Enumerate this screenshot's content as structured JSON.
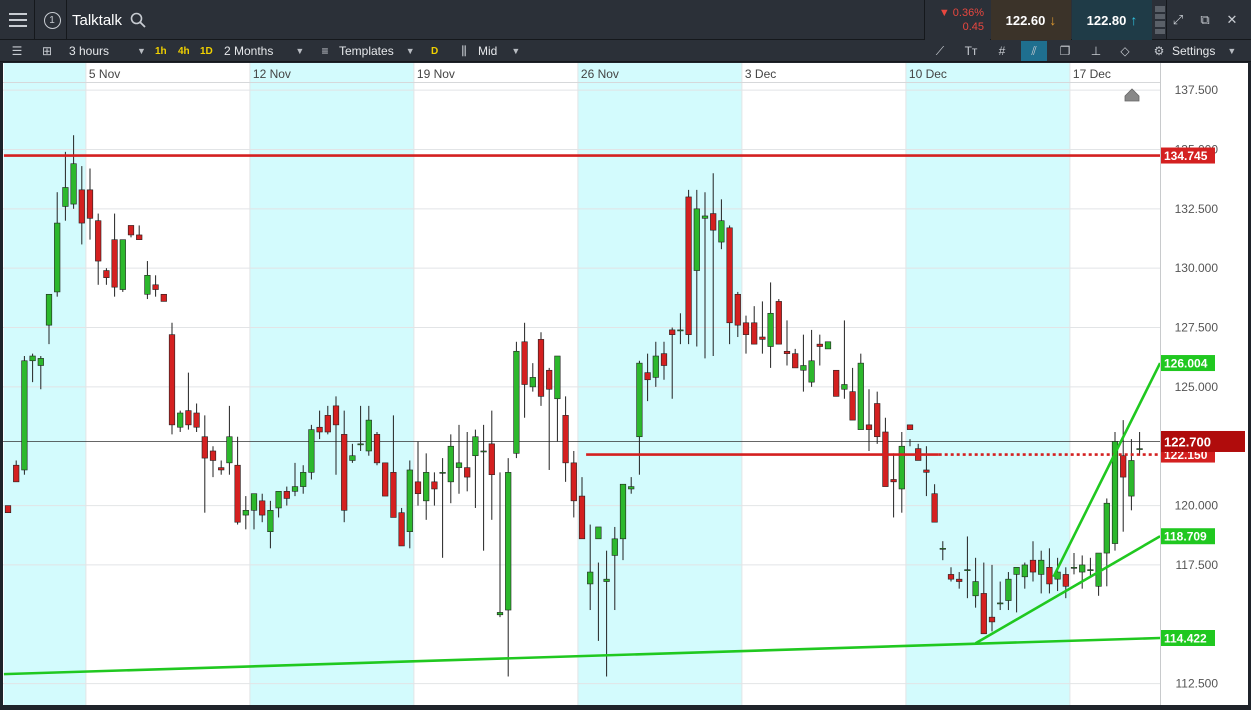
{
  "header": {
    "instrument": "Talktalk",
    "change_pct": "▼ 0.36%",
    "change_abs": "0.45",
    "sell_price": "122.60",
    "buy_price": "122.80"
  },
  "toolbar": {
    "interval": "3 hours",
    "tf_1h": "1h",
    "tf_4h": "4h",
    "tf_1d": "1D",
    "range": "2 Months",
    "templates": "Templates",
    "price_type_badge": "D",
    "price_type": "Mid",
    "settings": "Settings"
  },
  "icons": {
    "menu": "hamburger-menu-icon",
    "info": "info-icon",
    "search": "search-icon",
    "expand": "expand-icon",
    "popout": "popout-icon",
    "close": "close-icon",
    "draw": "draw-line-icon",
    "text": "text-icon",
    "crosshair": "crosshair-icon",
    "gear": "gear-icon"
  },
  "colors": {
    "up": "#2cb82c",
    "down": "#d42020",
    "band": "#d3fbfd",
    "red_line": "#d42020",
    "green_line": "#20c820"
  },
  "chart_data": {
    "type": "candlestick",
    "title": "",
    "xlabel": "",
    "ylabel": "",
    "ylim": [
      111.6,
      137.8
    ],
    "yticks": [
      "137.500",
      "135.000",
      "132.500",
      "130.000",
      "127.500",
      "125.000",
      "120.000",
      "117.500",
      "112.500"
    ],
    "ytick_values": [
      137.5,
      135.0,
      132.5,
      130.0,
      127.5,
      125.0,
      120.0,
      117.5,
      112.5
    ],
    "date_labels": [
      "5 Nov",
      "12 Nov",
      "19 Nov",
      "26 Nov",
      "3 Dec",
      "10 Dec",
      "17 Dec"
    ],
    "date_label_index": [
      9.5,
      29.5,
      49.5,
      69.5,
      89.5,
      109.5,
      129.5
    ],
    "shaded_bands_index": [
      [
        -0.5,
        9.5
      ],
      [
        29.5,
        49.5
      ],
      [
        69.5,
        89.5
      ],
      [
        109.5,
        129.5
      ]
    ],
    "candles": [
      [
        120.0,
        120.0,
        119.8,
        119.7
      ],
      [
        121.7,
        121.9,
        121.0,
        121.0
      ],
      [
        121.5,
        126.3,
        121.3,
        126.1
      ],
      [
        126.1,
        126.4,
        125.2,
        126.3
      ],
      [
        125.9,
        126.3,
        124.9,
        126.2
      ],
      [
        127.6,
        128.9,
        126.8,
        128.9
      ],
      [
        129.0,
        133.2,
        128.8,
        131.9
      ],
      [
        132.6,
        134.9,
        132.0,
        133.4
      ],
      [
        132.7,
        135.6,
        132.5,
        134.4
      ],
      [
        133.3,
        134.3,
        131.0,
        131.9
      ],
      [
        133.3,
        134.2,
        131.2,
        132.1
      ],
      [
        132.0,
        132.3,
        129.3,
        130.3
      ],
      [
        129.9,
        130.0,
        129.3,
        129.6
      ],
      [
        131.2,
        132.3,
        128.8,
        129.2
      ],
      [
        129.1,
        131.2,
        129.0,
        131.2
      ],
      [
        131.8,
        131.7,
        131.3,
        131.4
      ],
      [
        131.4,
        131.8,
        131.2,
        131.2
      ],
      [
        128.9,
        130.3,
        128.7,
        129.7
      ],
      [
        129.3,
        129.7,
        128.8,
        129.1
      ],
      [
        128.9,
        128.9,
        128.6,
        128.6
      ],
      [
        127.2,
        127.7,
        123.0,
        123.4
      ],
      [
        123.3,
        124.0,
        123.1,
        123.9
      ],
      [
        124.0,
        125.6,
        123.2,
        123.4
      ],
      [
        123.9,
        124.3,
        123.1,
        123.3
      ],
      [
        122.9,
        123.8,
        119.7,
        122.0
      ],
      [
        122.3,
        122.5,
        121.2,
        121.9
      ],
      [
        121.6,
        121.9,
        121.3,
        121.5
      ],
      [
        121.8,
        124.2,
        121.3,
        122.9
      ],
      [
        121.7,
        122.9,
        119.2,
        119.3
      ],
      [
        119.6,
        120.4,
        119.0,
        119.8
      ],
      [
        119.8,
        120.5,
        119.0,
        120.5
      ],
      [
        120.2,
        120.5,
        119.3,
        119.6
      ],
      [
        118.9,
        120.2,
        118.2,
        119.8
      ],
      [
        119.9,
        120.6,
        119.5,
        120.6
      ],
      [
        120.6,
        120.8,
        120.0,
        120.3
      ],
      [
        120.6,
        121.8,
        120.4,
        120.8
      ],
      [
        120.8,
        121.7,
        120.5,
        121.4
      ],
      [
        121.4,
        123.4,
        121.1,
        123.2
      ],
      [
        123.3,
        124.0,
        122.8,
        123.1
      ],
      [
        123.8,
        124.2,
        123.0,
        123.1
      ],
      [
        124.2,
        124.6,
        121.3,
        123.4
      ],
      [
        123.0,
        124.0,
        119.3,
        119.8
      ],
      [
        121.9,
        122.6,
        121.8,
        122.1
      ],
      [
        122.6,
        124.2,
        122.3,
        122.6
      ],
      [
        122.3,
        124.2,
        122.1,
        123.6
      ],
      [
        123.0,
        123.1,
        121.7,
        121.8
      ],
      [
        121.8,
        121.8,
        120.4,
        120.4
      ],
      [
        121.4,
        123.8,
        120.4,
        119.5
      ],
      [
        119.7,
        119.9,
        118.9,
        118.3
      ],
      [
        118.9,
        121.9,
        118.2,
        121.5
      ],
      [
        121.0,
        122.7,
        120.0,
        120.5
      ],
      [
        120.2,
        122.2,
        119.4,
        121.4
      ],
      [
        121.0,
        121.4,
        120.0,
        120.7
      ],
      [
        121.4,
        122.0,
        117.8,
        121.4
      ],
      [
        121.0,
        123.0,
        120.1,
        122.5
      ],
      [
        121.6,
        123.4,
        120.5,
        121.8
      ],
      [
        121.6,
        123.1,
        120.6,
        121.2
      ],
      [
        122.1,
        123.2,
        119.9,
        122.9
      ],
      [
        122.3,
        123.4,
        118.1,
        122.3
      ],
      [
        122.6,
        124.0,
        119.4,
        121.3
      ],
      [
        115.4,
        121.4,
        115.3,
        115.5
      ],
      [
        115.6,
        122.0,
        112.8,
        121.4
      ],
      [
        122.2,
        126.9,
        122.0,
        126.5
      ],
      [
        126.9,
        127.7,
        123.7,
        125.1
      ],
      [
        125.0,
        126.0,
        124.8,
        125.4
      ],
      [
        127.0,
        127.3,
        124.2,
        124.6
      ],
      [
        125.7,
        125.8,
        121.5,
        124.9
      ],
      [
        124.5,
        124.5,
        122.7,
        126.3
      ],
      [
        123.8,
        124.6,
        121.0,
        121.8
      ],
      [
        121.8,
        122.3,
        119.5,
        120.2
      ],
      [
        120.4,
        121.2,
        118.9,
        118.6
      ],
      [
        116.7,
        119.2,
        115.6,
        117.2
      ],
      [
        118.6,
        117.6,
        114.3,
        119.1
      ],
      [
        116.8,
        118.1,
        112.8,
        116.9
      ],
      [
        117.9,
        119.1,
        115.6,
        118.6
      ],
      [
        118.6,
        118.9,
        117.7,
        120.9
      ],
      [
        120.7,
        121.2,
        120.5,
        120.8
      ],
      [
        122.9,
        126.1,
        121.3,
        126.0
      ],
      [
        125.6,
        126.4,
        124.4,
        125.3
      ],
      [
        125.4,
        126.9,
        125.0,
        126.3
      ],
      [
        126.4,
        126.9,
        125.3,
        125.9
      ],
      [
        127.4,
        127.5,
        124.5,
        127.2
      ],
      [
        127.4,
        128.1,
        126.8,
        127.4
      ],
      [
        133.0,
        133.3,
        126.8,
        127.2
      ],
      [
        129.9,
        133.3,
        126.7,
        132.5
      ],
      [
        132.1,
        133.2,
        126.2,
        132.2
      ],
      [
        132.3,
        134.0,
        126.3,
        131.6
      ],
      [
        131.1,
        132.9,
        130.8,
        132.0
      ],
      [
        131.7,
        131.8,
        126.8,
        127.7
      ],
      [
        128.9,
        129.0,
        127.1,
        127.6
      ],
      [
        127.7,
        128.0,
        126.4,
        127.2
      ],
      [
        127.7,
        128.4,
        126.8,
        126.8
      ],
      [
        127.1,
        128.6,
        126.4,
        127.0
      ],
      [
        126.7,
        129.4,
        125.8,
        128.1
      ],
      [
        128.6,
        128.7,
        126.8,
        126.8
      ],
      [
        126.5,
        127.8,
        125.9,
        126.4
      ],
      [
        126.4,
        126.6,
        126.0,
        125.8
      ],
      [
        125.7,
        127.2,
        124.8,
        125.9
      ],
      [
        125.2,
        127.4,
        125.0,
        126.1
      ],
      [
        126.8,
        127.2,
        125.9,
        126.7
      ],
      [
        126.6,
        126.9,
        126.6,
        126.9
      ],
      [
        125.7,
        125.7,
        124.6,
        124.6
      ],
      [
        124.9,
        127.8,
        124.5,
        125.1
      ],
      [
        124.8,
        125.8,
        123.7,
        123.6
      ],
      [
        123.2,
        126.4,
        123.3,
        126.0
      ],
      [
        123.4,
        124.9,
        122.3,
        123.2
      ],
      [
        124.3,
        124.8,
        122.6,
        122.9
      ],
      [
        123.1,
        123.7,
        121.2,
        120.8
      ],
      [
        121.1,
        122.2,
        119.5,
        121.0
      ],
      [
        120.7,
        123.1,
        119.7,
        122.5
      ],
      [
        123.4,
        122.8,
        122.5,
        123.2
      ],
      [
        122.4,
        122.6,
        122.0,
        121.9
      ],
      [
        121.5,
        122.5,
        120.4,
        121.4
      ],
      [
        120.5,
        120.9,
        119.6,
        119.3
      ],
      [
        118.2,
        118.5,
        117.7,
        118.2
      ],
      [
        117.1,
        117.4,
        116.8,
        116.9
      ],
      [
        116.9,
        117.2,
        116.5,
        116.8
      ],
      [
        117.3,
        118.7,
        116.1,
        117.3
      ],
      [
        116.2,
        117.8,
        115.7,
        116.8
      ],
      [
        116.3,
        117.6,
        115.4,
        114.6
      ],
      [
        115.3,
        117.5,
        114.7,
        115.1
      ],
      [
        115.9,
        116.8,
        115.6,
        115.9
      ],
      [
        116.0,
        117.2,
        115.6,
        116.9
      ],
      [
        117.1,
        117.4,
        115.5,
        117.4
      ],
      [
        117.0,
        117.6,
        116.5,
        117.5
      ],
      [
        117.7,
        118.5,
        116.8,
        117.2
      ],
      [
        117.1,
        118.1,
        116.3,
        117.7
      ],
      [
        117.4,
        118.2,
        116.3,
        116.7
      ],
      [
        116.9,
        117.8,
        116.4,
        117.2
      ],
      [
        117.1,
        117.4,
        116.1,
        116.6
      ],
      [
        117.4,
        118.0,
        117.1,
        117.4
      ],
      [
        117.2,
        117.9,
        116.5,
        117.5
      ],
      [
        117.3,
        117.8,
        117.0,
        117.3
      ],
      [
        116.6,
        117.8,
        116.2,
        118.0
      ],
      [
        118.0,
        120.3,
        116.6,
        120.1
      ],
      [
        118.4,
        123.1,
        118.1,
        122.7
      ],
      [
        122.1,
        123.6,
        118.9,
        121.2
      ],
      [
        120.4,
        122.8,
        119.8,
        121.9
      ],
      [
        122.4,
        123.1,
        122.1,
        122.4
      ]
    ],
    "horizontal_lines": [
      {
        "price": 134.745,
        "label": "134.745",
        "from_index": -0.5,
        "style": "solid"
      },
      {
        "price": 122.15,
        "label": "122.150",
        "from_index": 70.5,
        "to_index": 113.5,
        "style": "solid"
      },
      {
        "price": 122.15,
        "label": "",
        "from_index": 113.5,
        "style": "dotted"
      }
    ],
    "trend_lines": [
      {
        "label": "114.422",
        "from": [
          -0.5,
          112.9
        ],
        "to": [
          140.5,
          114.422
        ]
      },
      {
        "label": "118.709",
        "from": [
          118.0,
          114.2
        ],
        "to": [
          140.5,
          118.709
        ]
      },
      {
        "label": "126.004",
        "from": [
          127.5,
          117.0
        ],
        "to": [
          140.5,
          126.004
        ]
      }
    ],
    "current_price": {
      "price": 122.7,
      "label": "122.700"
    }
  }
}
